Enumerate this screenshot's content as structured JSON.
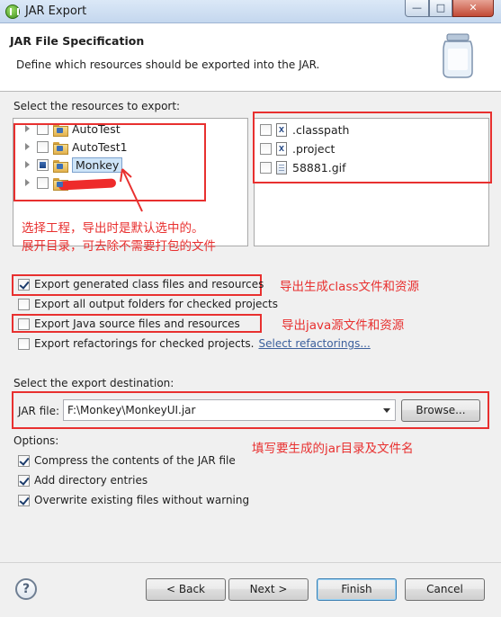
{
  "window": {
    "title": "JAR Export",
    "icon": "eclipse-export-icon",
    "controls": {
      "minimize": "—",
      "maximize": "□",
      "close": "✕"
    }
  },
  "header": {
    "title": "JAR File Specification",
    "description": "Define which resources should be exported into the JAR."
  },
  "resources": {
    "label": "Select the resources to export:",
    "projects": [
      {
        "label": "AutoTest",
        "checked": false,
        "selected": false
      },
      {
        "label": "AutoTest1",
        "checked": false,
        "selected": false
      },
      {
        "label": "Monkey",
        "checked": "partial",
        "selected": true
      },
      {
        "label": "",
        "checked": false,
        "selected": false
      }
    ],
    "files": [
      {
        "label": ".classpath",
        "icon": "x-file-icon"
      },
      {
        "label": ".project",
        "icon": "x-file-icon"
      },
      {
        "label": "58881.gif",
        "icon": "gif-file-icon"
      }
    ]
  },
  "annotations": {
    "tree_note_line1": "选择工程，导出时是默认选中的。",
    "tree_note_line2": "展开目录，可去除不需要打包的文件",
    "class_note": "导出生成class文件和资源",
    "java_note": "导出java源文件和资源",
    "jar_note": "填写要生成的jar目录及文件名"
  },
  "export_options": [
    {
      "label": "Export generated class files and resources",
      "checked": true
    },
    {
      "label": "Export all output folders for checked projects",
      "checked": false
    },
    {
      "label": "Export Java source files and resources",
      "checked": false
    },
    {
      "label": "Export refactorings for checked projects.",
      "checked": false,
      "link": "Select refactorings..."
    }
  ],
  "destination": {
    "label": "Select the export destination:",
    "jar_label": "JAR file:",
    "jar_value": "F:\\Monkey\\MonkeyUI.jar",
    "browse": "Browse..."
  },
  "options": {
    "label": "Options:",
    "items": [
      {
        "label": "Compress the contents of the JAR file",
        "checked": true
      },
      {
        "label": "Add directory entries",
        "checked": true
      },
      {
        "label": "Overwrite existing files without warning",
        "checked": true
      }
    ]
  },
  "footer": {
    "help": "?",
    "back": "< Back",
    "next": "Next >",
    "finish": "Finish",
    "cancel": "Cancel"
  },
  "colors": {
    "annotation": "#e8302f",
    "selection": "#cde4f8",
    "link": "#3b5f9c"
  }
}
